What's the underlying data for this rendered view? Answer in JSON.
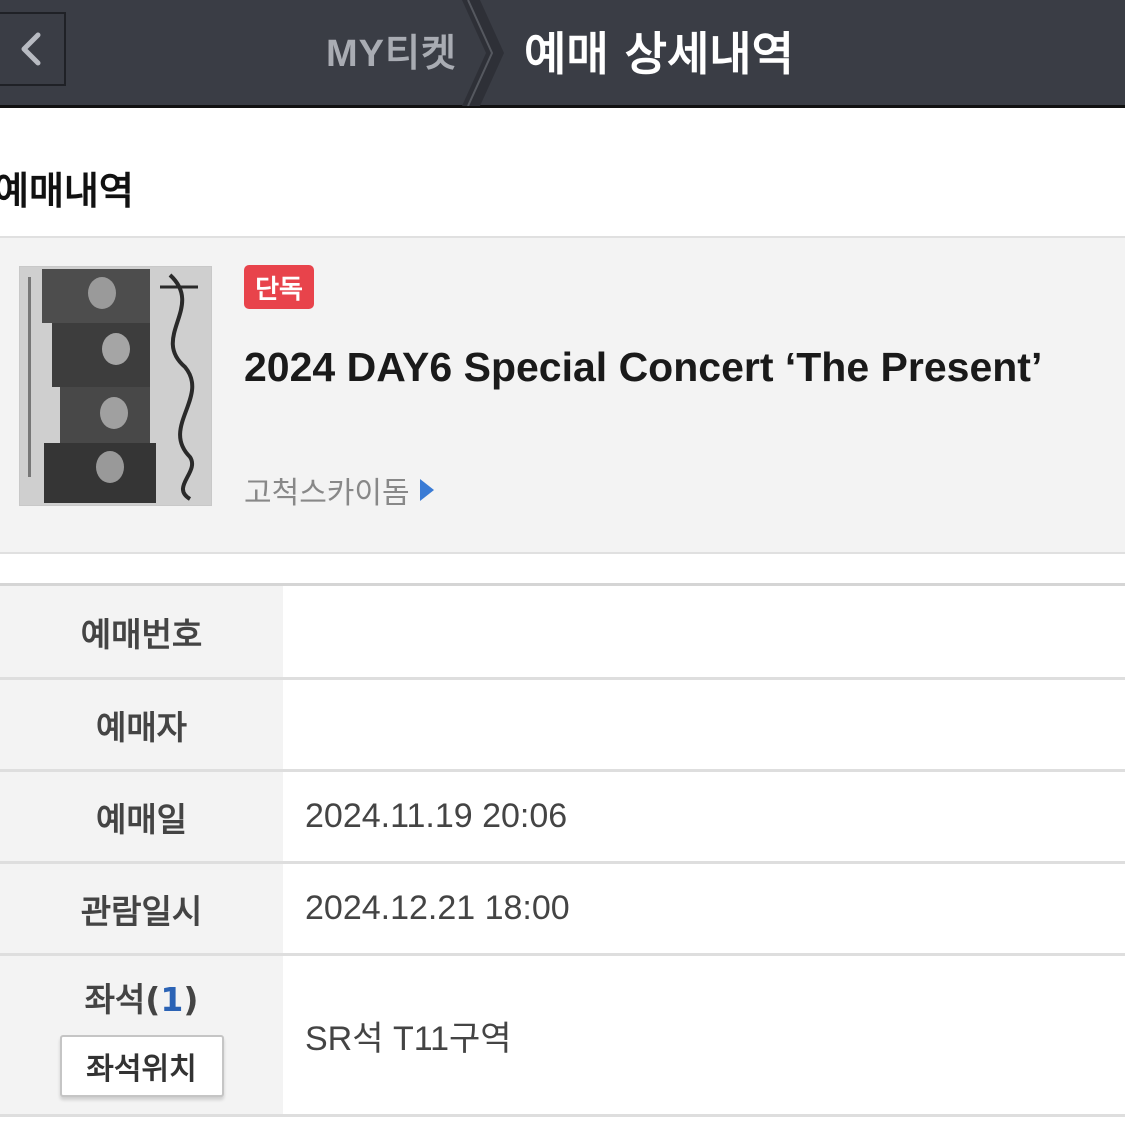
{
  "header": {
    "back_icon": "chevron-left-icon",
    "breadcrumb_prev": "MY티켓",
    "title": "예매 상세내역"
  },
  "section_title": "예매내역",
  "event": {
    "badge": "단독",
    "badge_color": "#e8434b",
    "title": "2024 DAY6 Special Concert ‘The Present’",
    "venue": "고척스카이돔",
    "venue_arrow_color": "#3a7bd5",
    "poster_icon": "concert-poster-image"
  },
  "details": {
    "booking_number_label": "예매번호",
    "booking_number_value": "",
    "booker_label": "예매자",
    "booker_value": "",
    "booking_date_label": "예매일",
    "booking_date_value": "2024.11.19 20:06",
    "viewing_datetime_label": "관람일시",
    "viewing_datetime_value": "2024.12.21 18:00",
    "seat_label": "좌석(",
    "seat_count": "1",
    "seat_label_close": ")",
    "seat_location_button": "좌석위치",
    "seat_value": "SR석 T11구역"
  }
}
